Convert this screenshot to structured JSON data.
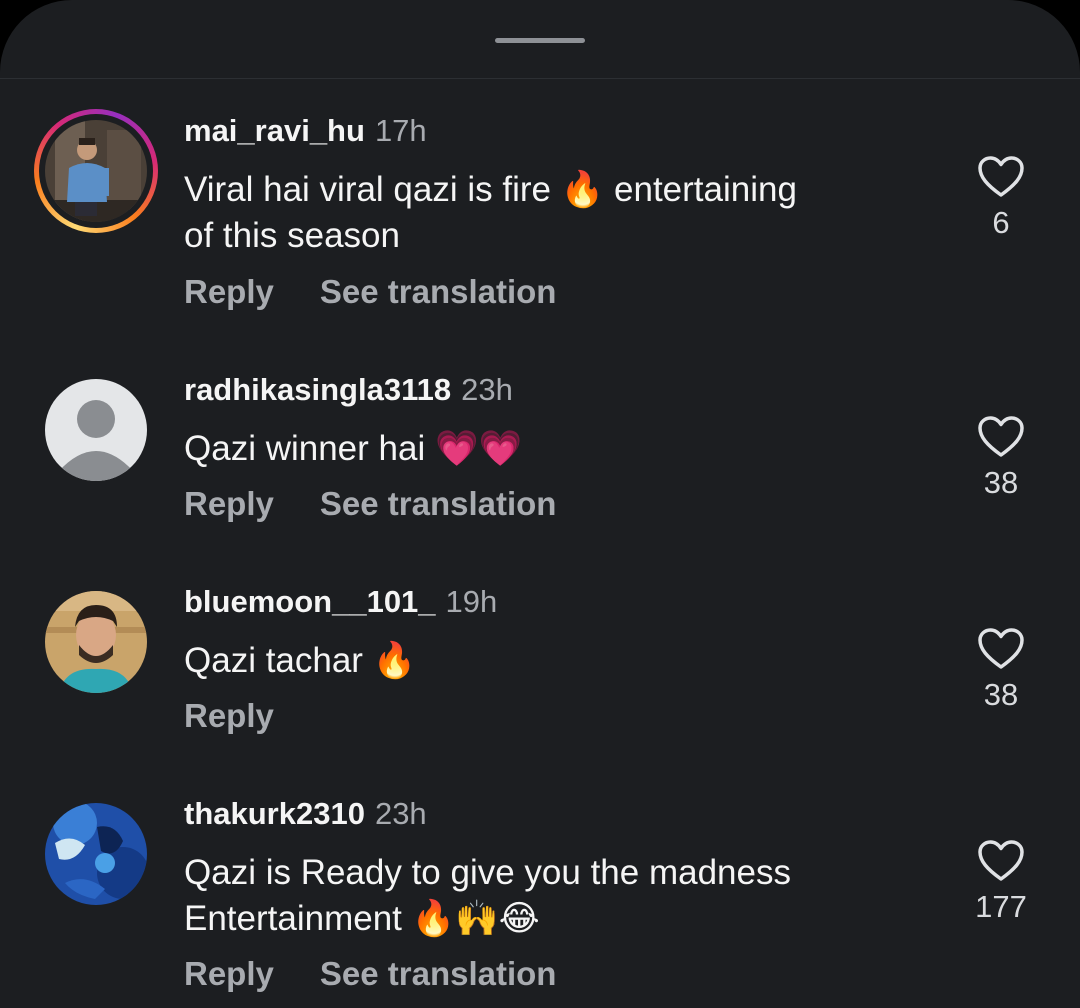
{
  "comments": [
    {
      "username": "mai_ravi_hu",
      "time": "17h",
      "text_line1": "Viral hai viral qazi is fire 🔥 entertaining",
      "text_line2": "of this season",
      "reply_label": "Reply",
      "translate_label": "See translation",
      "likes": "6",
      "avatar_icon": "user-photo-avatar",
      "has_story_ring": true
    },
    {
      "username": "radhikasingla3118",
      "time": "23h",
      "text_line1": "Qazi winner hai 💗💗",
      "reply_label": "Reply",
      "translate_label": "See translation",
      "likes": "38",
      "avatar_icon": "default-avatar"
    },
    {
      "username": "bluemoon__101_",
      "time": "19h",
      "text_line1": "Qazi tachar 🔥",
      "reply_label": "Reply",
      "likes": "38",
      "avatar_icon": "user-photo-avatar"
    },
    {
      "username": "thakurk2310",
      "time": "23h",
      "text_line1": "Qazi is Ready to give you the madness",
      "text_line2": "Entertainment 🔥🙌😂",
      "reply_label": "Reply",
      "translate_label": "See translation",
      "likes": "177",
      "avatar_icon": "user-photo-avatar"
    }
  ],
  "colors": {
    "sheet_background": "#1c1e21",
    "primary_text": "#f5f5f5",
    "secondary_text": "#a8abb0"
  }
}
